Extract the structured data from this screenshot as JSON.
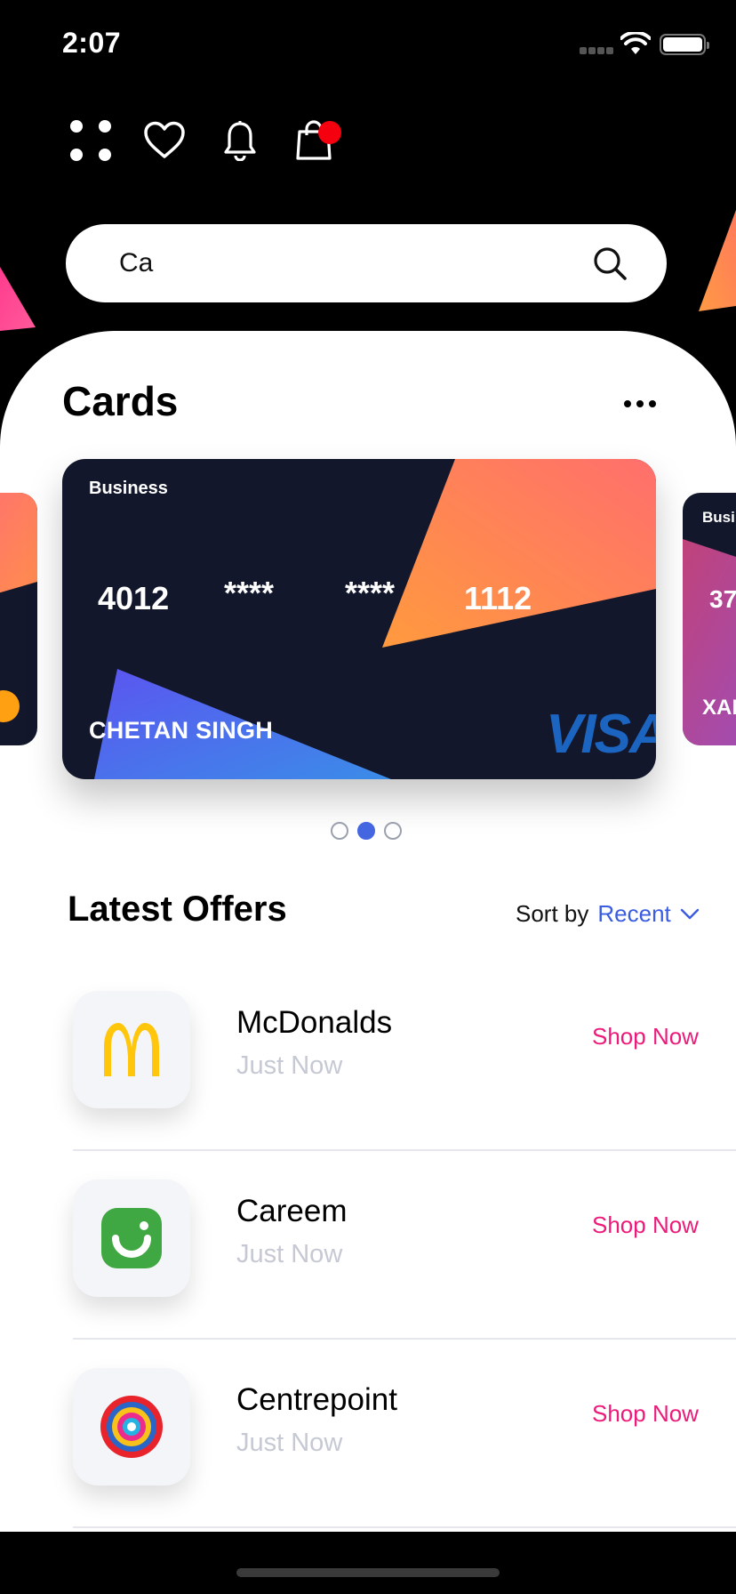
{
  "status_bar": {
    "time": "2:07"
  },
  "top_icons": [
    "menu-grid-icon",
    "heart-icon",
    "bell-icon",
    "shopping-bag-icon"
  ],
  "search": {
    "value": "Ca",
    "placeholder": ""
  },
  "cards_section": {
    "title": "Cards",
    "more_label": "More options",
    "active_index": 1,
    "page_count": 3,
    "main_card": {
      "type": "Business",
      "number": [
        "4012",
        "****",
        "****",
        "1112"
      ],
      "holder": "CHETAN SINGH",
      "network": "VISA"
    },
    "next_card_peek": {
      "type": "Busi",
      "number": "37",
      "holder": "XAN"
    }
  },
  "offers_section": {
    "title": "Latest Offers",
    "sort_label": "Sort by",
    "sort_value": "Recent",
    "items": [
      {
        "name": "McDonalds",
        "time": "Just Now",
        "cta": "Shop Now",
        "logo": "mcdonalds-logo"
      },
      {
        "name": "Careem",
        "time": "Just Now",
        "cta": "Shop Now",
        "logo": "careem-logo"
      },
      {
        "name": "Centrepoint",
        "time": "Just Now",
        "cta": "Shop Now",
        "logo": "centrepoint-logo"
      }
    ]
  },
  "colors": {
    "background": "#000000",
    "card_dark": "#12172b",
    "accent_blue": "#3a5ce0",
    "shop_now_pink": "#ee1a7a",
    "badge_red": "#f5000f"
  }
}
